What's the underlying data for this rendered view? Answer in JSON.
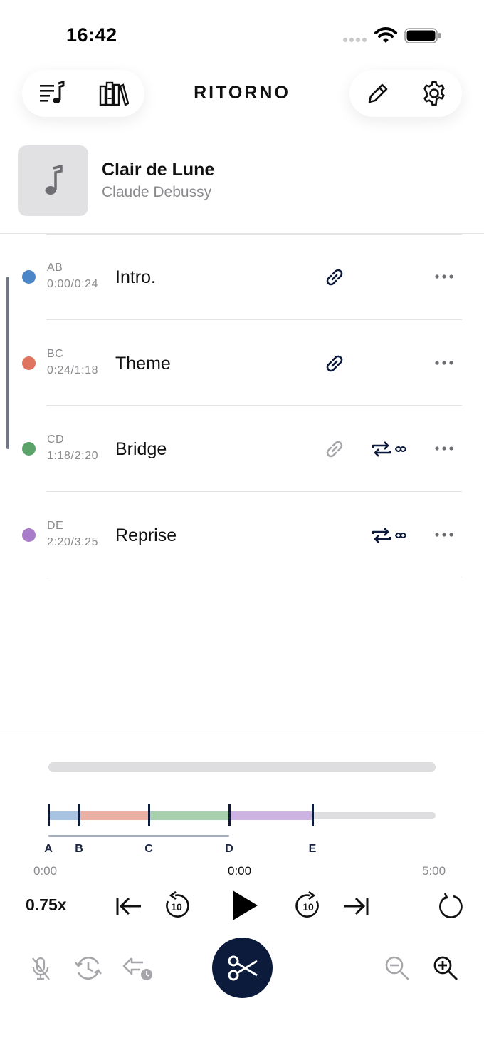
{
  "status": {
    "time": "16:42"
  },
  "header": {
    "title": "RITORNO"
  },
  "track": {
    "title": "Clair de Lune",
    "artist": "Claude Debussy"
  },
  "sections": [
    {
      "code": "AB",
      "range": "0:00/0:24",
      "name": "Intro.",
      "color": "#4a86c8",
      "linked": true,
      "link_active": true,
      "loop": false
    },
    {
      "code": "BC",
      "range": "0:24/1:18",
      "name": "Theme",
      "color": "#e07460",
      "linked": true,
      "link_active": true,
      "loop": false
    },
    {
      "code": "CD",
      "range": "1:18/2:20",
      "name": "Bridge",
      "color": "#5aa46a",
      "linked": true,
      "link_active": false,
      "loop": true
    },
    {
      "code": "DE",
      "range": "2:20/3:25",
      "name": "Reprise",
      "color": "#a87cc8",
      "linked": false,
      "link_active": false,
      "loop": true
    }
  ],
  "player": {
    "markers": [
      "A",
      "B",
      "C",
      "D",
      "E"
    ],
    "time_start": "0:00",
    "time_current": "0:00",
    "time_end": "5:00",
    "speed": "0.75x",
    "skip_seconds": "10"
  },
  "colors": {
    "accent": "#0c1a3b",
    "muted": "#8a8a8e"
  }
}
